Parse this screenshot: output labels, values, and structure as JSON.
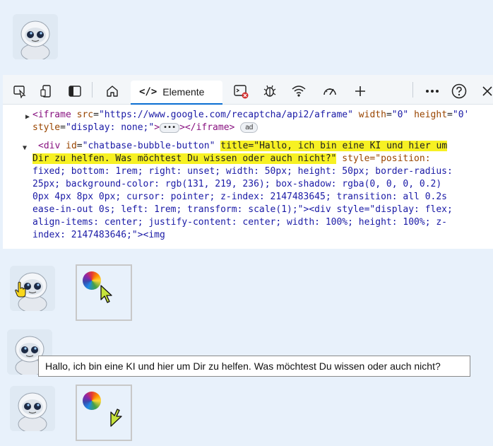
{
  "devtools": {
    "active_tab": "Elemente",
    "toolbar_icons": [
      "inspect-icon",
      "device-emulation-icon",
      "sidebar-icon",
      "home-icon",
      "elements-icon",
      "console-icon",
      "bug-icon",
      "network-icon",
      "performance-icon",
      "plus-icon",
      "more-icon",
      "help-icon",
      "close-icon"
    ]
  },
  "code": {
    "line1": {
      "open": "<iframe",
      "attr_src": "src",
      "val_src": "\"https://www.google.com/recaptcha/api2/aframe\"",
      "attr_width": "width",
      "val_width": "\"0\"",
      "attr_height": "height",
      "val_height": "\"0'"
    },
    "line2": {
      "attr_style": "style",
      "val_style": "\"display: none;\"",
      "close": "></iframe>",
      "badge": "ad"
    },
    "div": {
      "open": "<div",
      "attr_id": "id",
      "val_id": "\"chatbase-bubble-button\"",
      "title_part1": "title=\"Hallo, ich bin eine KI und hier um",
      "title_part2": "Dir zu helfen. Was möchtest Du wissen oder auch nicht?\"",
      "style_start": "style=\"position:",
      "line4": "fixed; bottom: 1rem; right: unset; width: 50px; height: 50px; border-radius:",
      "line5": "25px; background-color: rgb(131, 219, 236); box-shadow: rgba(0, 0, 0, 0.2)",
      "line6": "0px 4px 8px 0px; cursor: pointer; z-index: 2147483645; transition: all 0.2s",
      "line7": "ease-in-out 0s; left: 1rem; transform: scale(1);\"><div style=\"display: flex;",
      "line8": "align-items: center; justify-content: center; width: 100%; height: 100%; z-",
      "line9": "index: 2147483646;\"><img"
    }
  },
  "tooltip": "Hallo, ich bin eine KI und hier um Dir zu helfen. Was möchtest Du wissen oder auch nicht?",
  "colors": {
    "highlight": "#f7f123",
    "cursor_fill": "#c6e33b",
    "accent": "#0a6ed1"
  }
}
